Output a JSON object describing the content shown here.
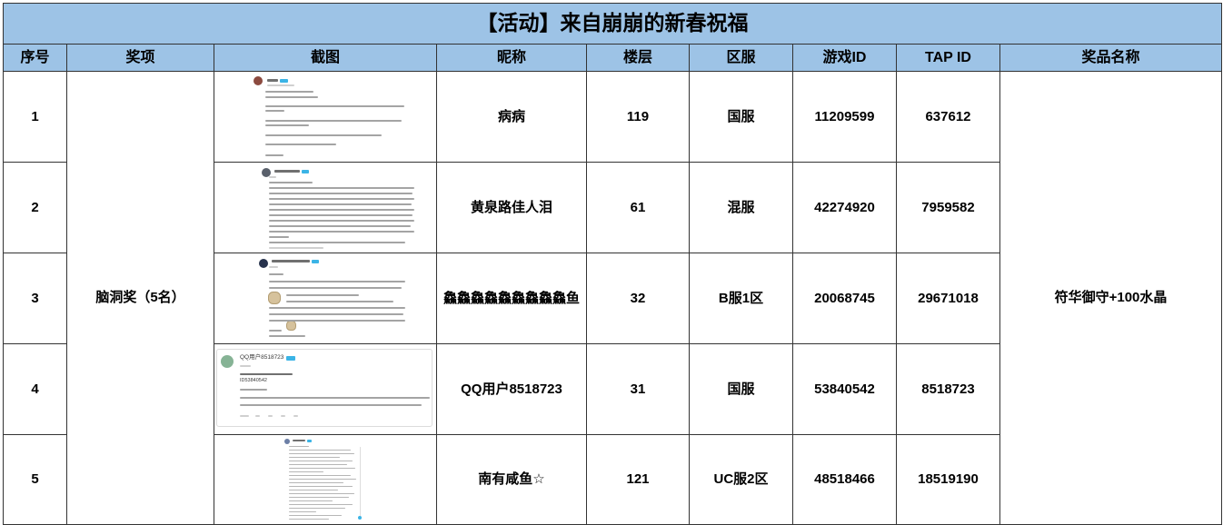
{
  "title": "【活动】来自崩崩的新春祝福",
  "columns": [
    "序号",
    "奖项",
    "截图",
    "昵称",
    "楼层",
    "区服",
    "游戏ID",
    "TAP ID",
    "奖品名称"
  ],
  "award": "脑洞奖（5名）",
  "prize": "符华御守+100水晶",
  "rows": [
    {
      "index": "1",
      "nickname": "病病",
      "floor": "119",
      "server": "国服",
      "game_id": "11209599",
      "tap_id": "637612"
    },
    {
      "index": "2",
      "nickname": "黄泉路佳人泪",
      "floor": "61",
      "server": "混服",
      "game_id": "42274920",
      "tap_id": "7959582"
    },
    {
      "index": "3",
      "nickname": "鱻鱻鱻鱻鱻鱻鱻鱻鱻鱼",
      "floor": "32",
      "server": "B服1区",
      "game_id": "20068745",
      "tap_id": "29671018"
    },
    {
      "index": "4",
      "nickname": "QQ用户8518723",
      "floor": "31",
      "server": "国服",
      "game_id": "53840542",
      "tap_id": "8518723",
      "screenshot": {
        "user": "QQ用户8518723",
        "user_id": "ID53840542"
      }
    },
    {
      "index": "5",
      "nickname": "南有咸鱼☆",
      "floor": "121",
      "server": "UC服2区",
      "game_id": "48518466",
      "tap_id": "18519190"
    }
  ],
  "colors": {
    "header_background": "#9DC3E6",
    "grid_border": "#333333",
    "text": "#000000",
    "badge": "#3BB4E6"
  }
}
